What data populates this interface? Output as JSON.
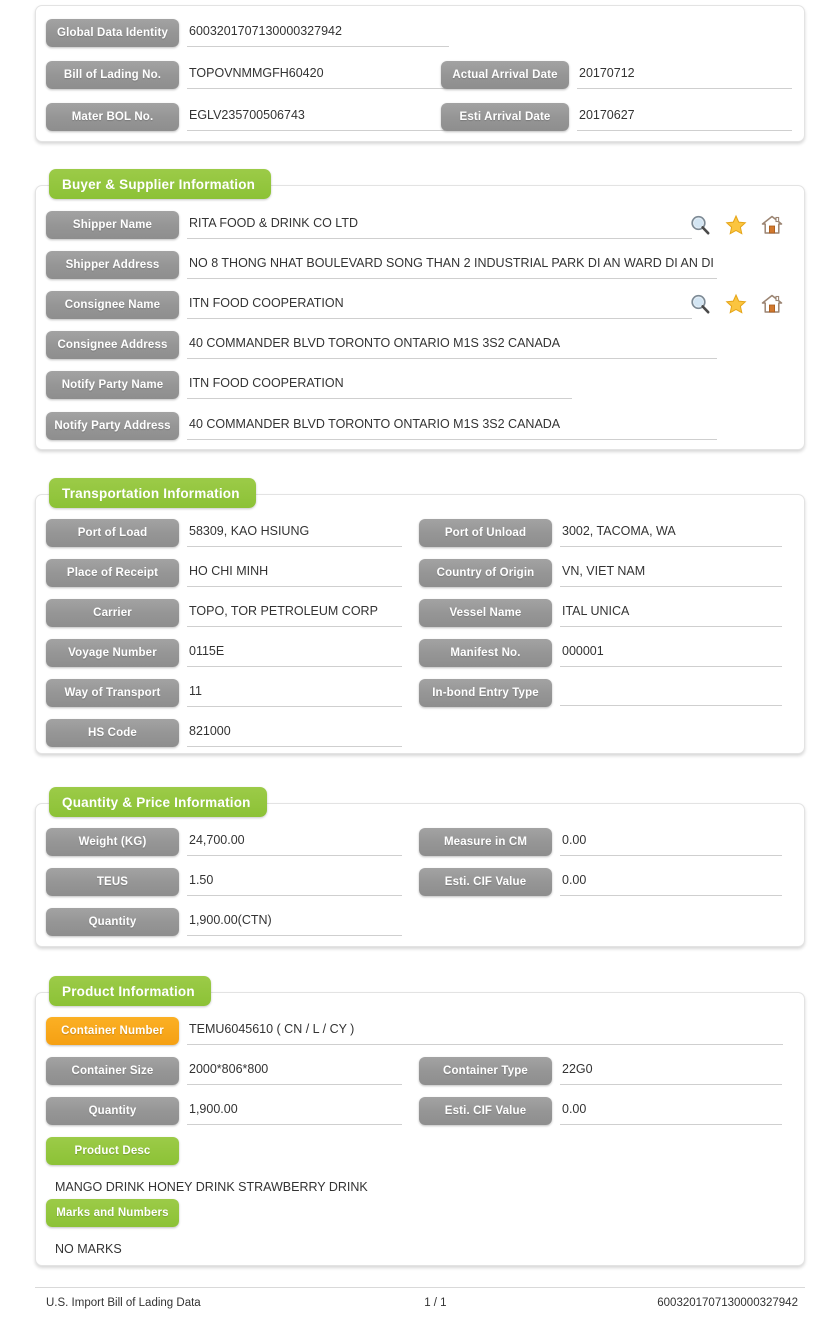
{
  "colors": {
    "green": "#8cc236",
    "orange": "#f5a013",
    "gray": "#969696",
    "value_text": "#333333",
    "underline": "#cfcfcf"
  },
  "sections": {
    "identity": {
      "fields_left": [
        {
          "label": "Global Data Identity",
          "value": "6003201707130000327942"
        },
        {
          "label": "Bill of Lading No.",
          "value": "TOPOVNMMGFH60420"
        },
        {
          "label": "Mater BOL No.",
          "value": "EGLV235700506743"
        }
      ],
      "fields_right": [
        {
          "label": "Actual Arrival Date",
          "value": "20170712"
        },
        {
          "label": "Esti Arrival Date",
          "value": "20170627"
        }
      ]
    },
    "buyer_supplier": {
      "title": "Buyer & Supplier Information",
      "fields": [
        {
          "label": "Shipper Name",
          "value": "RITA FOOD & DRINK CO LTD"
        },
        {
          "label": "Shipper Address",
          "value": "NO 8 THONG NHAT BOULEVARD SONG THAN 2 INDUSTRIAL PARK DI AN WARD DI AN DI"
        },
        {
          "label": "Consignee Name",
          "value": "ITN FOOD COOPERATION"
        },
        {
          "label": "Consignee Address",
          "value": "40 COMMANDER BLVD TORONTO ONTARIO M1S 3S2 CANADA"
        },
        {
          "label": "Notify Party Name",
          "value": "ITN FOOD COOPERATION"
        },
        {
          "label": "Notify Party Address",
          "value": "40 COMMANDER BLVD TORONTO ONTARIO M1S 3S2 CANADA"
        }
      ],
      "icons": [
        "search-icon",
        "star-icon",
        "home-icon"
      ]
    },
    "transportation": {
      "title": "Transportation Information",
      "fields_left": [
        {
          "label": "Port of Load",
          "value": "58309, KAO HSIUNG"
        },
        {
          "label": "Place of Receipt",
          "value": "HO CHI MINH"
        },
        {
          "label": "Carrier",
          "value": "TOPO, TOR PETROLEUM CORP"
        },
        {
          "label": "Voyage Number",
          "value": "0115E"
        },
        {
          "label": "Way of Transport",
          "value": "11"
        },
        {
          "label": "HS Code",
          "value": "821000"
        }
      ],
      "fields_right": [
        {
          "label": "Port of Unload",
          "value": "3002, TACOMA, WA"
        },
        {
          "label": "Country of Origin",
          "value": "VN, VIET NAM"
        },
        {
          "label": "Vessel Name",
          "value": "ITAL UNICA"
        },
        {
          "label": "Manifest No.",
          "value": "000001"
        },
        {
          "label": "In-bond Entry Type",
          "value": ""
        }
      ]
    },
    "quantity_price": {
      "title": "Quantity & Price Information",
      "fields_left": [
        {
          "label": "Weight (KG)",
          "value": "24,700.00"
        },
        {
          "label": "TEUS",
          "value": "1.50"
        },
        {
          "label": "Quantity",
          "value": "1,900.00(CTN)"
        }
      ],
      "fields_right": [
        {
          "label": "Measure in CM",
          "value": "0.00"
        },
        {
          "label": "Esti. CIF Value",
          "value": "0.00"
        }
      ]
    },
    "product": {
      "title": "Product Information",
      "container_number": {
        "label": "Container Number",
        "value": "TEMU6045610 ( CN / L / CY )"
      },
      "fields_left": [
        {
          "label": "Container Size",
          "value": "2000*806*800"
        },
        {
          "label": "Quantity",
          "value": "1,900.00"
        }
      ],
      "fields_right": [
        {
          "label": "Container Type",
          "value": "22G0"
        },
        {
          "label": "Esti. CIF Value",
          "value": "0.00"
        }
      ],
      "product_desc": {
        "label": "Product Desc",
        "value": "MANGO DRINK HONEY DRINK STRAWBERRY DRINK"
      },
      "marks": {
        "label": "Marks and Numbers",
        "value": "NO MARKS"
      }
    }
  },
  "footer": {
    "left": "U.S. Import Bill of Lading Data",
    "page": "1 / 1",
    "right": "6003201707130000327942"
  }
}
